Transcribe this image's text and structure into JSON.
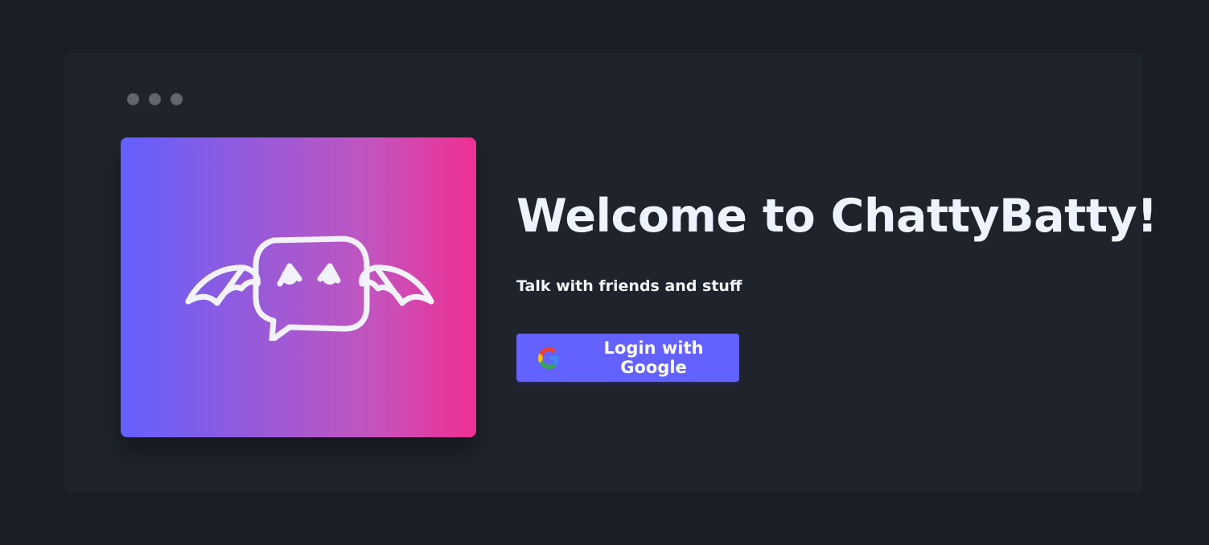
{
  "header": {
    "window_dots": [
      "dot",
      "dot",
      "dot"
    ]
  },
  "hero": {
    "logo_icon": "chattybatty-bat-chat-icon",
    "gradient_start": "#6360ff",
    "gradient_end": "#f02f93"
  },
  "main": {
    "title": "Welcome to ChattyBatty!",
    "subtitle": "Talk with friends and stuff",
    "login_label": "Login with Google",
    "login_icon": "google-icon",
    "button_color": "#6361ff"
  }
}
